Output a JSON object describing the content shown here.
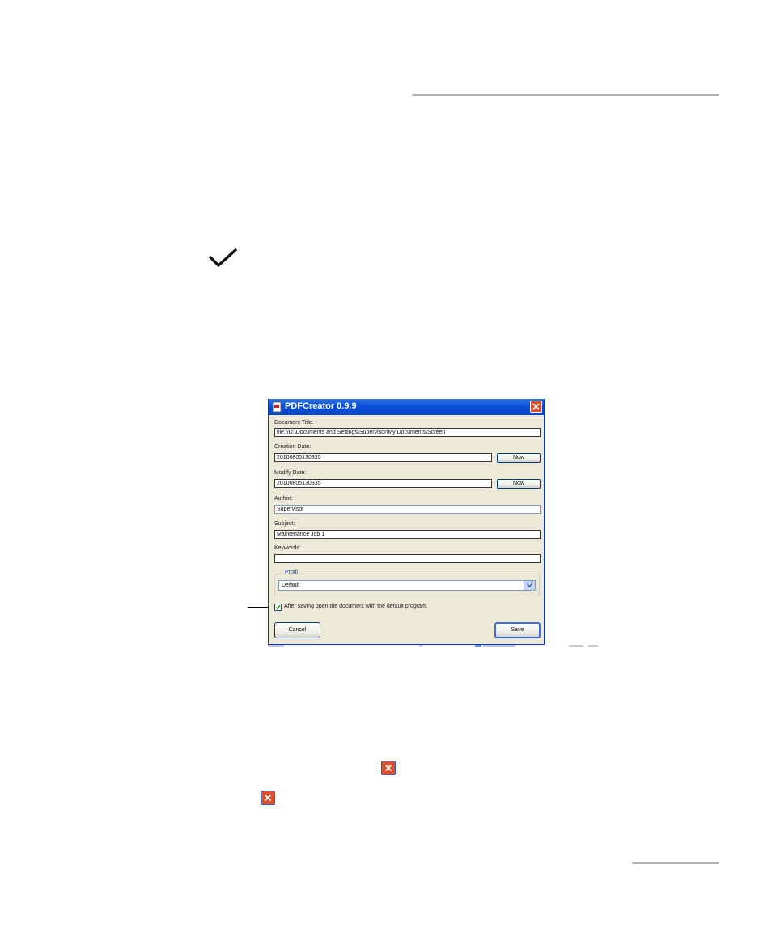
{
  "dialog": {
    "title": "PDFCreator 0.9.9",
    "fields": {
      "document_title_label": "Document Title:",
      "document_title_value": "file://D:\\Documents and Settings\\Supervisor\\My Documents\\Screen",
      "creation_date_label": "Creation Date:",
      "creation_date_value": "20100805130335",
      "modify_date_label": "Modify Date:",
      "modify_date_value": "20100805130335",
      "now_label": "Now",
      "author_label": "Author:",
      "author_value": "Supervisor",
      "subject_label": "Subject:",
      "subject_value": "Maintenance Job 1",
      "keywords_label": "Keywords:",
      "keywords_value": ""
    },
    "profile": {
      "group_label": "Profil",
      "selected": "Default"
    },
    "open_after_saving": {
      "label": "After saving open the document with the default program.",
      "checked": true
    },
    "buttons": {
      "cancel": "Cancel",
      "save": "Save"
    }
  },
  "colors": {
    "titlebar": "#0a4ed8",
    "close": "#d9522d",
    "dialog_bg": "#ece9d8",
    "rule": "#b3b3b3"
  },
  "icons": [
    "checkmark-icon",
    "close-x-icon"
  ]
}
